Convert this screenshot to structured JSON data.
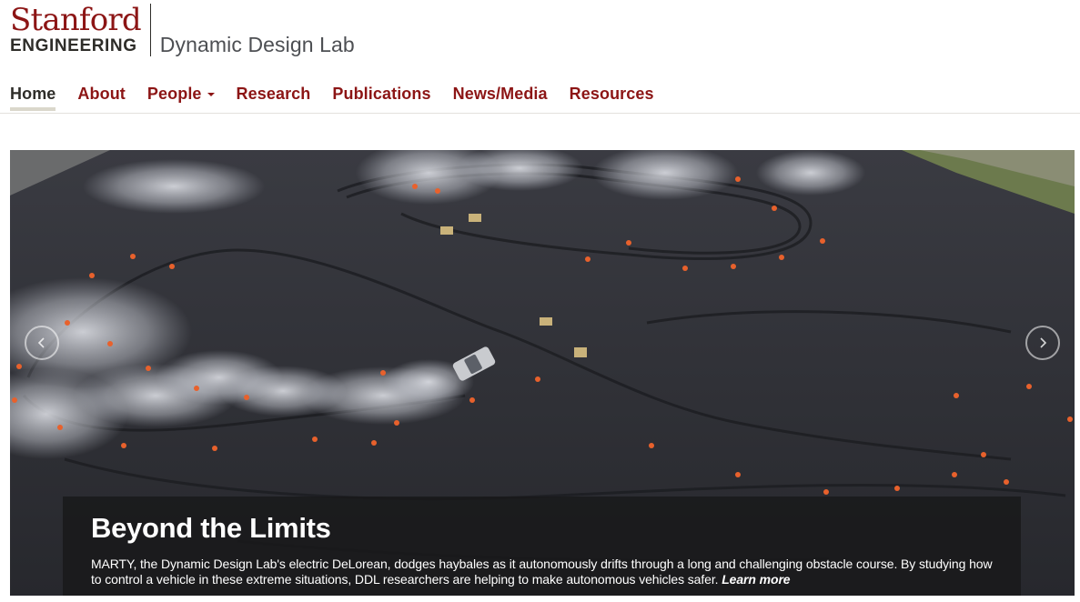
{
  "brand": {
    "logo_top": "Stanford",
    "logo_bottom": "ENGINEERING",
    "site_name": "Dynamic Design Lab"
  },
  "nav": {
    "items": [
      {
        "label": "Home",
        "active": true
      },
      {
        "label": "About"
      },
      {
        "label": "People",
        "has_dropdown": true
      },
      {
        "label": "Research"
      },
      {
        "label": "Publications"
      },
      {
        "label": "News/Media"
      },
      {
        "label": "Resources"
      }
    ]
  },
  "carousel": {
    "prev_icon": "chevron-left-icon",
    "next_icon": "chevron-right-icon",
    "slide": {
      "image_subject": "aerial photo of a DeLorean drifting on a tarmac obstacle course with cones and haybales",
      "title": "Beyond the Limits",
      "text": "MARTY, the Dynamic Design Lab's electric DeLorean, dodges haybales as it autonomously drifts through a long and challenging obstacle course. By studying how to control a vehicle in these extreme situations, DDL researchers are helping to make autonomous vehicles safer.",
      "link": "Learn more"
    }
  },
  "colors": {
    "cardinal": "#8c1515",
    "text_dark": "#2e2d29",
    "nav_active_underline": "#dad7cb",
    "caption_bg": "#18181a"
  }
}
